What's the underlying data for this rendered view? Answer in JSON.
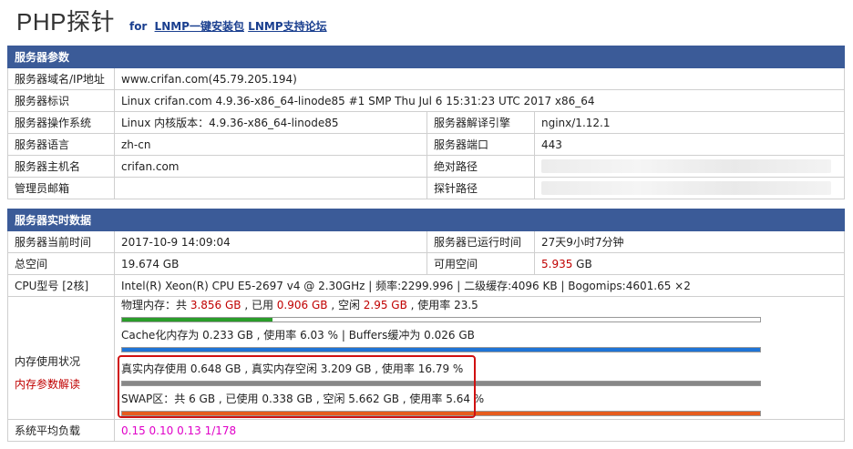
{
  "header": {
    "title": "PHP探针",
    "for_label": "for",
    "link1": "LNMP一键安装包",
    "link2": "LNMP支持论坛"
  },
  "server_params": {
    "heading": "服务器参数",
    "domain_label": "服务器域名/IP地址",
    "domain_value": "www.crifan.com(45.79.205.194)",
    "ident_label": "服务器标识",
    "ident_value": "Linux crifan.com 4.9.36-x86_64-linode85 #1 SMP Thu Jul 6 15:31:23 UTC 2017 x86_64",
    "os_label": "服务器操作系统",
    "os_value": "Linux  内核版本：4.9.36-x86_64-linode85",
    "engine_label": "服务器解译引擎",
    "engine_value": "nginx/1.12.1",
    "lang_label": "服务器语言",
    "lang_value": "zh-cn",
    "port_label": "服务器端口",
    "port_value": "443",
    "host_label": "服务器主机名",
    "host_value": "crifan.com",
    "abspath_label": "绝对路径",
    "admin_label": "管理员邮箱",
    "admin_value": "",
    "probe_path_label": "探针路径"
  },
  "realtime": {
    "heading": "服务器实时数据",
    "time_label": "服务器当前时间",
    "time_value": "2017-10-9 14:09:04",
    "uptime_label": "服务器已运行时间",
    "uptime_value": "27天9小时7分钟",
    "total_label": "总空间",
    "total_value": "19.674 GB",
    "avail_label": "可用空间",
    "avail_num": "5.935",
    "avail_unit": " GB",
    "cpu_label": "CPU型号 [2核]",
    "cpu_value": "Intel(R) Xeon(R) CPU E5-2697 v4 @ 2.30GHz | 频率:2299.996 | 二级缓存:4096 KB | Bogomips:4601.65 ×2",
    "mem_label": "内存使用状况",
    "mem_help_label": "内存参数解读",
    "mem": {
      "phys_prefix": "物理内存：共 ",
      "phys_total": "3.856 GB",
      "phys_used_prefix": " , 已用 ",
      "phys_used": "0.906 GB",
      "phys_free_prefix": " , 空闲 ",
      "phys_free": "2.95 GB",
      "phys_rate": " , 使用率 23.5",
      "phys_fraction": 0.235,
      "cache_text": "Cache化内存为 0.233 GB , 使用率 6.03 % | Buffers缓冲为 0.026 GB",
      "cache_fraction": 1.0,
      "real_text": "真实内存使用 0.648 GB , 真实内存空闲 3.209 GB , 使用率 16.79 %",
      "real_fraction": 1.0,
      "swap_text": "SWAP区：共 6 GB , 已使用 0.338 GB , 空闲 5.662 GB , 使用率 5.64 %",
      "swap_fraction": 1.0
    },
    "load_label": "系统平均负载",
    "load_value": "0.15 0.10 0.13 1/178"
  }
}
